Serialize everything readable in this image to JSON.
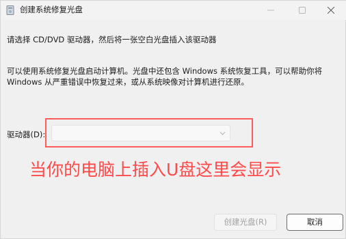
{
  "window": {
    "title": "创建系统修复光盘",
    "app_icon": "disc-drive-icon",
    "controls": [
      "minimize-icon",
      "maximize-icon",
      "close-icon"
    ]
  },
  "content": {
    "instruction": "请选择 CD/DVD 驱动器，然后将一张空白光盘插入该驱动器",
    "description_line1": "可以使用系统修复光盘启动计算机。光盘中还包含 Windows 系统恢复工具，可以帮助你将",
    "description_line2": "Windows 从严重错误中恢复过来，或从系统映像对计算机进行还原。"
  },
  "drive": {
    "label": "驱动器(D):",
    "selected_value": ""
  },
  "annotation": {
    "text": "当你的电脑上插入U盘这里会显示",
    "color": "#ff4a4a"
  },
  "buttons": {
    "create_label": "创建光盘(R)",
    "cancel_label": "取消"
  }
}
